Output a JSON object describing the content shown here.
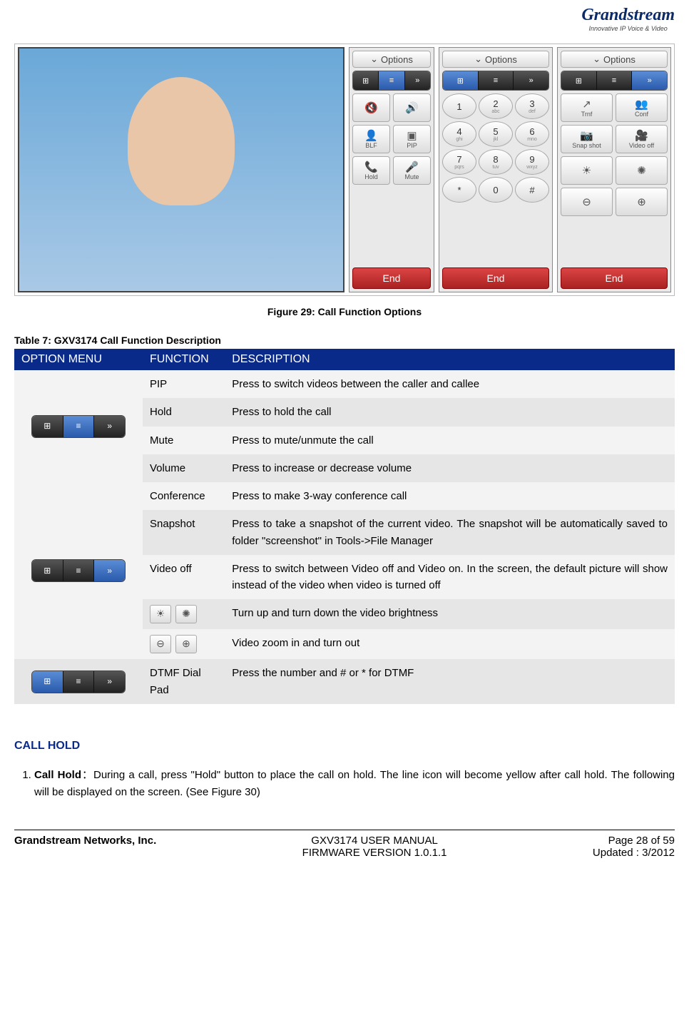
{
  "logo": {
    "name": "Grandstream",
    "tagline": "Innovative IP Voice & Video"
  },
  "figure": {
    "options_label": "Options",
    "end_label": "End",
    "panel1_buttons": [
      {
        "icon": "🔇",
        "label": ""
      },
      {
        "icon": "🔊",
        "label": ""
      },
      {
        "icon": "👤",
        "label": "BLF"
      },
      {
        "icon": "▣",
        "label": "PIP"
      },
      {
        "icon": "📞",
        "label": "Hold"
      },
      {
        "icon": "🎤",
        "label": "Mute"
      }
    ],
    "dial_keys": [
      {
        "n": "1",
        "s": ""
      },
      {
        "n": "2",
        "s": "abc"
      },
      {
        "n": "3",
        "s": "def"
      },
      {
        "n": "4",
        "s": "ghi"
      },
      {
        "n": "5",
        "s": "jkl"
      },
      {
        "n": "6",
        "s": "mno"
      },
      {
        "n": "7",
        "s": "pqrs"
      },
      {
        "n": "8",
        "s": "tuv"
      },
      {
        "n": "9",
        "s": "wxyz"
      },
      {
        "n": "*",
        "s": ""
      },
      {
        "n": "0",
        "s": ""
      },
      {
        "n": "#",
        "s": ""
      }
    ],
    "panel3_buttons": [
      {
        "icon": "↗",
        "label": "Trnf"
      },
      {
        "icon": "👥",
        "label": "Conf"
      },
      {
        "icon": "📷",
        "label": "Snap shot"
      },
      {
        "icon": "🎥",
        "label": "Video off"
      },
      {
        "icon": "☀",
        "label": ""
      },
      {
        "icon": "✺",
        "label": ""
      },
      {
        "icon": "⊖",
        "label": ""
      },
      {
        "icon": "⊕",
        "label": ""
      }
    ],
    "caption": "Figure 29: Call Function Options"
  },
  "table": {
    "caption": "Table 7: GXV3174 Call Function Description",
    "headers": {
      "c1": "OPTION MENU",
      "c2": "FUNCTION",
      "c3": "DESCRIPTION"
    },
    "group1": [
      {
        "func": "PIP",
        "desc": "Press to switch videos between the caller and callee"
      },
      {
        "func": "Hold",
        "desc": "Press to hold the call"
      },
      {
        "func": "Mute",
        "desc": "Press to mute/unmute the call"
      },
      {
        "func": "Volume",
        "desc": "Press to increase or decrease volume"
      }
    ],
    "group2": [
      {
        "func": "Conference",
        "desc": "Press to make 3-way conference call"
      },
      {
        "func": "Snapshot",
        "desc": "Press to take a snapshot of the current video. The snapshot will be automatically saved to folder \"screenshot\" in Tools->File Manager"
      },
      {
        "func": "Video off",
        "desc": "Press to switch between Video off and Video on. In the screen, the default picture will show instead of the video when video is turned off"
      },
      {
        "func": "__brightness_icons__",
        "desc": "Turn up and turn down the video brightness"
      },
      {
        "func": "__zoom_icons__",
        "desc": "Video zoom in and turn out"
      }
    ],
    "group3": [
      {
        "func": "DTMF Dial Pad",
        "desc": "Press the number and # or * for DTMF"
      }
    ]
  },
  "section": {
    "title": "CALL HOLD",
    "item_label": "Call Hold",
    "item_sep": "：",
    "item_text": "During a call, press \"Hold\" button to place the call on hold. The line icon will become yellow after call hold. The following will be displayed on the screen. (See Figure 30)"
  },
  "footer": {
    "company": "Grandstream Networks, Inc.",
    "manual": "GXV3174 USER MANUAL",
    "firmware": "FIRMWARE VERSION 1.0.1.1",
    "page": "Page 28 of 59",
    "updated": "Updated : 3/2012"
  }
}
